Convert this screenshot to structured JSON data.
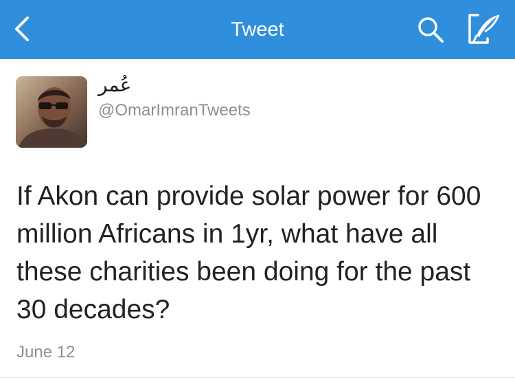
{
  "navbar": {
    "title": "Tweet",
    "background_color": "#2f8fdd",
    "back_icon": "chevron-left-icon",
    "search_icon": "search-icon",
    "compose_icon": "compose-tweet-icon"
  },
  "tweet": {
    "author": {
      "display_name": "عُمر",
      "handle": "@OmarImranTweets",
      "avatar_icon": "avatar-photo"
    },
    "text": "If Akon can provide solar power for 600 million Africans in 1yr, what have all these charities been doing for the past 30 decades?",
    "date": "June 12"
  }
}
